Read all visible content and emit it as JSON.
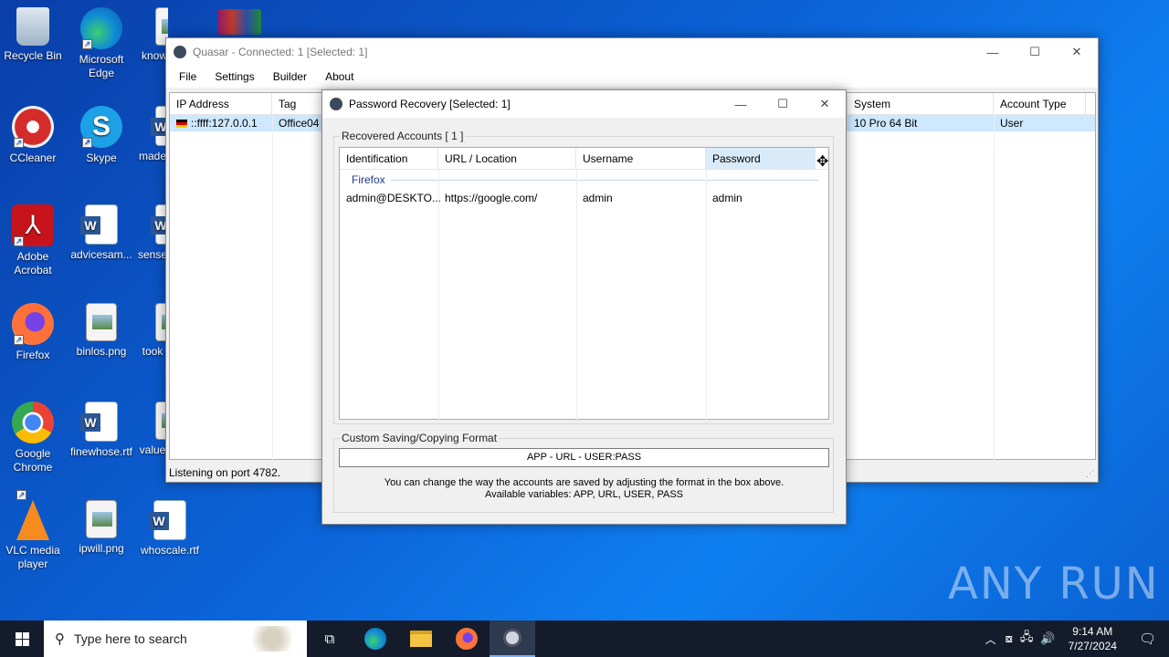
{
  "desktop_icons": [
    {
      "label": "Recycle Bin",
      "icon": "recycle-bin-icon"
    },
    {
      "label": "Microsoft Edge",
      "icon": "edge-icon"
    },
    {
      "label": "know",
      "icon": "image-file-icon"
    },
    {
      "label": "CCleaner",
      "icon": "ccleaner-icon"
    },
    {
      "label": "Skype",
      "icon": "skype-icon"
    },
    {
      "label": "made",
      "icon": "word-file-icon"
    },
    {
      "label": "Adobe Acrobat",
      "icon": "acrobat-icon"
    },
    {
      "label": "advicesam...",
      "icon": "word-file-icon"
    },
    {
      "label": "sense",
      "icon": "word-file-icon"
    },
    {
      "label": "Firefox",
      "icon": "firefox-icon"
    },
    {
      "label": "binlos.png",
      "icon": "image-file-icon"
    },
    {
      "label": "took",
      "icon": "image-file-icon"
    },
    {
      "label": "Google Chrome",
      "icon": "chrome-icon"
    },
    {
      "label": "finewhose.rtf",
      "icon": "word-file-icon"
    },
    {
      "label": "value",
      "icon": "image-file-icon"
    },
    {
      "label": "VLC media player",
      "icon": "vlc-icon"
    },
    {
      "label": "ipwill.png",
      "icon": "image-file-icon"
    },
    {
      "label": "whoscale.rtf",
      "icon": "word-file-icon"
    }
  ],
  "main_window": {
    "title": "Quasar - Connected: 1 [Selected: 1]",
    "menu": [
      "File",
      "Settings",
      "Builder",
      "About"
    ],
    "columns": [
      "IP Address",
      "Tag",
      "System",
      "Account Type"
    ],
    "row": {
      "ip": "::ffff:127.0.0.1",
      "tag": "Office04",
      "system": "10 Pro 64 Bit",
      "account_type": "User"
    },
    "status": "Listening on port 4782."
  },
  "dialog": {
    "title": "Password Recovery [Selected: 1]",
    "group_title": "Recovered Accounts [ 1 ]",
    "columns": [
      "Identification",
      "URL / Location",
      "Username",
      "Password"
    ],
    "group_name": "Firefox",
    "rows": [
      {
        "identification": "admin@DESKTO...",
        "url": "https://google.com/",
        "username": "admin",
        "password": "admin"
      }
    ],
    "format_group_title": "Custom Saving/Copying Format",
    "format_value": "APP - URL - USER:PASS",
    "help_line1": "You can change the way the accounts are saved by adjusting the format in the box above.",
    "help_line2": "Available variables: APP, URL, USER, PASS"
  },
  "taskbar": {
    "search_placeholder": "Type here to search",
    "time": "9:14 AM",
    "date": "7/27/2024"
  },
  "watermark": "ANY RUN",
  "colors": {
    "selection": "#cde8ff",
    "taskbar": "#141c2c",
    "desktop": "#0b63d8"
  }
}
